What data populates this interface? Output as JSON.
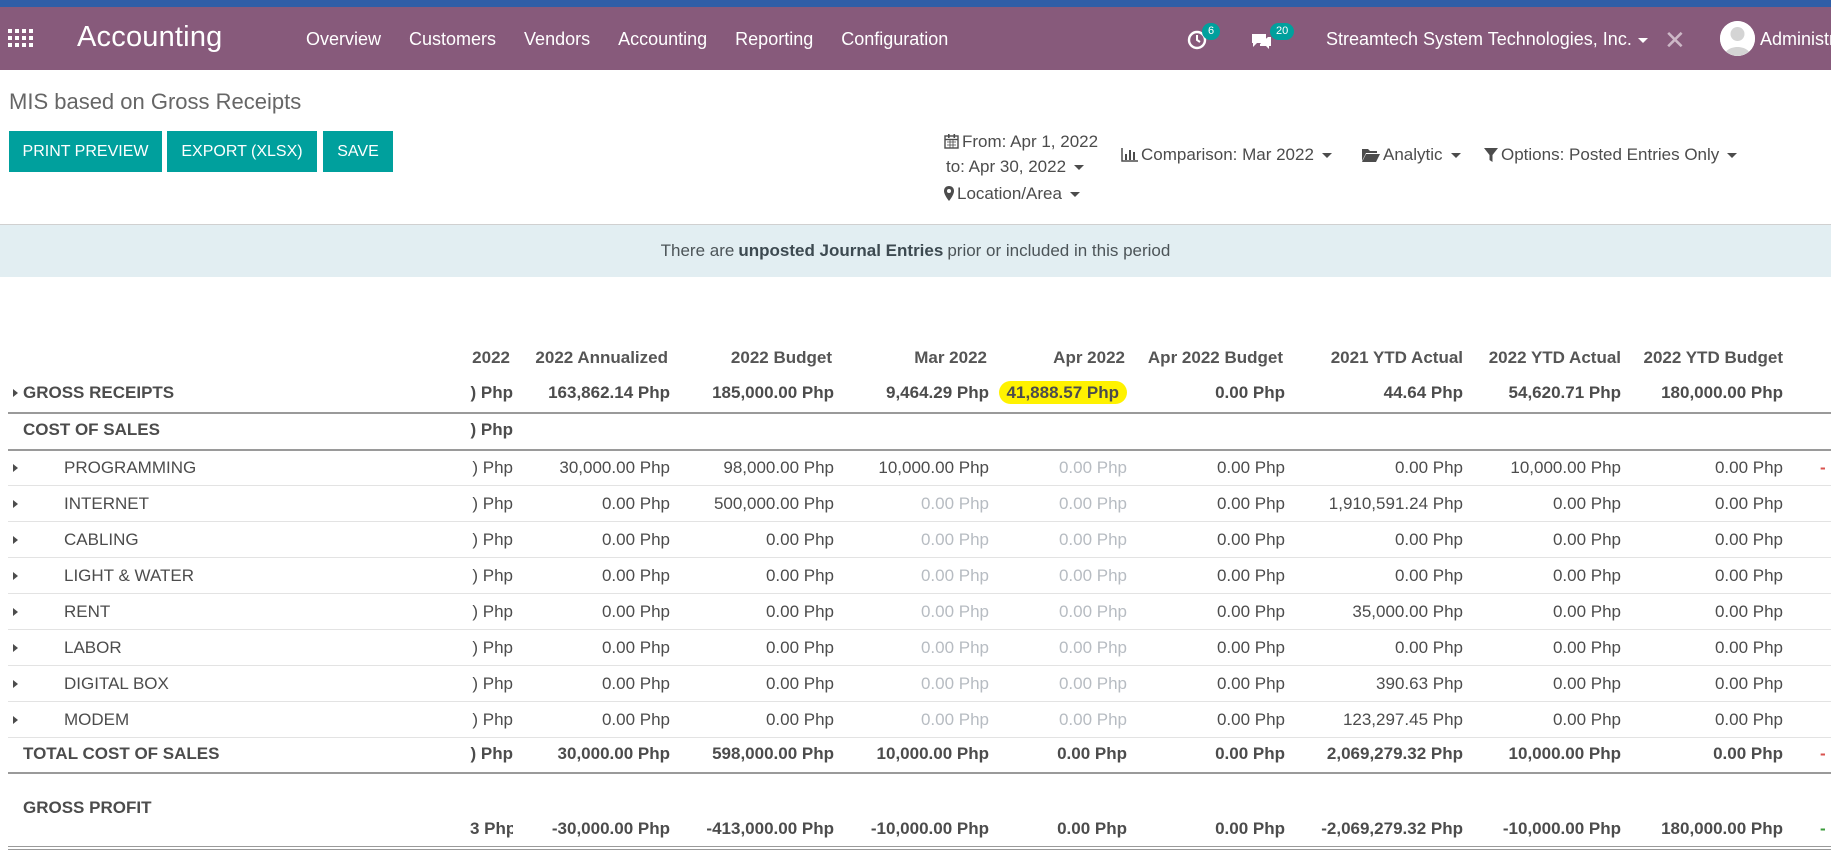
{
  "navbar": {
    "brand": "Accounting",
    "menu": [
      "Overview",
      "Customers",
      "Vendors",
      "Accounting",
      "Reporting",
      "Configuration"
    ],
    "activity_count": "6",
    "messages_count": "20",
    "company": "Streamtech System Technologies, Inc.",
    "user": "Administrator"
  },
  "page": {
    "title": "MIS based on Gross Receipts",
    "buttons": {
      "print_preview": "PRINT PREVIEW",
      "export": "EXPORT (XLSX)",
      "save": "SAVE"
    }
  },
  "filters": {
    "from": "From: Apr 1, 2022",
    "to": "to: Apr 30, 2022",
    "location": "Location/Area",
    "comparison": "Comparison: Mar 2022",
    "analytic": "Analytic",
    "options": "Options: Posted Entries Only"
  },
  "alert": {
    "pre": "There are",
    "bold": "unposted Journal Entries",
    "post": "prior or included in this period"
  },
  "table": {
    "headers": [
      "2022",
      "2022 Annualized",
      "2022 Budget",
      "Mar 2022",
      "Apr 2022",
      "Apr 2022 Budget",
      "2021 YTD Actual",
      "2022 YTD Actual",
      "2022 YTD Budget"
    ],
    "gross_receipts": {
      "label": "GROSS RECEIPTS",
      "values": [
        ") Php",
        "163,862.14 Php",
        "185,000.00 Php",
        "9,464.29 Php",
        "41,888.57 Php",
        "0.00 Php",
        "44.64 Php",
        "54,620.71 Php",
        "180,000.00 Php"
      ]
    },
    "cost_of_sales": {
      "label": "COST OF SALES",
      "value": ") Php"
    },
    "lines": [
      {
        "label": "PROGRAMMING",
        "values": [
          ") Php",
          "30,000.00 Php",
          "98,000.00 Php",
          "10,000.00 Php",
          "0.00 Php",
          "0.00 Php",
          "0.00 Php",
          "10,000.00 Php",
          "0.00 Php"
        ]
      },
      {
        "label": "INTERNET",
        "values": [
          ") Php",
          "0.00 Php",
          "500,000.00 Php",
          "0.00 Php",
          "0.00 Php",
          "0.00 Php",
          "1,910,591.24 Php",
          "0.00 Php",
          "0.00 Php"
        ]
      },
      {
        "label": "CABLING",
        "values": [
          ") Php",
          "0.00 Php",
          "0.00 Php",
          "0.00 Php",
          "0.00 Php",
          "0.00 Php",
          "0.00 Php",
          "0.00 Php",
          "0.00 Php"
        ]
      },
      {
        "label": "LIGHT & WATER",
        "values": [
          ") Php",
          "0.00 Php",
          "0.00 Php",
          "0.00 Php",
          "0.00 Php",
          "0.00 Php",
          "0.00 Php",
          "0.00 Php",
          "0.00 Php"
        ]
      },
      {
        "label": "RENT",
        "values": [
          ") Php",
          "0.00 Php",
          "0.00 Php",
          "0.00 Php",
          "0.00 Php",
          "0.00 Php",
          "35,000.00 Php",
          "0.00 Php",
          "0.00 Php"
        ]
      },
      {
        "label": "LABOR",
        "values": [
          ") Php",
          "0.00 Php",
          "0.00 Php",
          "0.00 Php",
          "0.00 Php",
          "0.00 Php",
          "0.00 Php",
          "0.00 Php",
          "0.00 Php"
        ]
      },
      {
        "label": "DIGITAL BOX",
        "values": [
          ") Php",
          "0.00 Php",
          "0.00 Php",
          "0.00 Php",
          "0.00 Php",
          "0.00 Php",
          "390.63 Php",
          "0.00 Php",
          "0.00 Php"
        ]
      },
      {
        "label": "MODEM",
        "values": [
          ") Php",
          "0.00 Php",
          "0.00 Php",
          "0.00 Php",
          "0.00 Php",
          "0.00 Php",
          "123,297.45 Php",
          "0.00 Php",
          "0.00 Php"
        ]
      }
    ],
    "total_cost": {
      "label": "TOTAL COST OF SALES",
      "values": [
        ") Php",
        "30,000.00 Php",
        "598,000.00 Php",
        "10,000.00 Php",
        "0.00 Php",
        "0.00 Php",
        "2,069,279.32 Php",
        "10,000.00 Php",
        "0.00 Php"
      ]
    },
    "gross_profit": {
      "label": "GROSS PROFIT",
      "values": [
        "3 Php",
        "-30,000.00 Php",
        "-413,000.00 Php",
        "-10,000.00 Php",
        "0.00 Php",
        "0.00 Php",
        "-2,069,279.32 Php",
        "-10,000.00 Php",
        "180,000.00 Php"
      ]
    },
    "right_edge_marks": [
      "-",
      "-",
      "-"
    ],
    "muted_columns_note": "Mar 2022 and Apr 2022 zero values shown greyed"
  },
  "colors": {
    "navbar": "#875a7b",
    "primary_button": "#00a09d",
    "alert_bg": "#e2eef2",
    "highlight": "#fff200"
  }
}
